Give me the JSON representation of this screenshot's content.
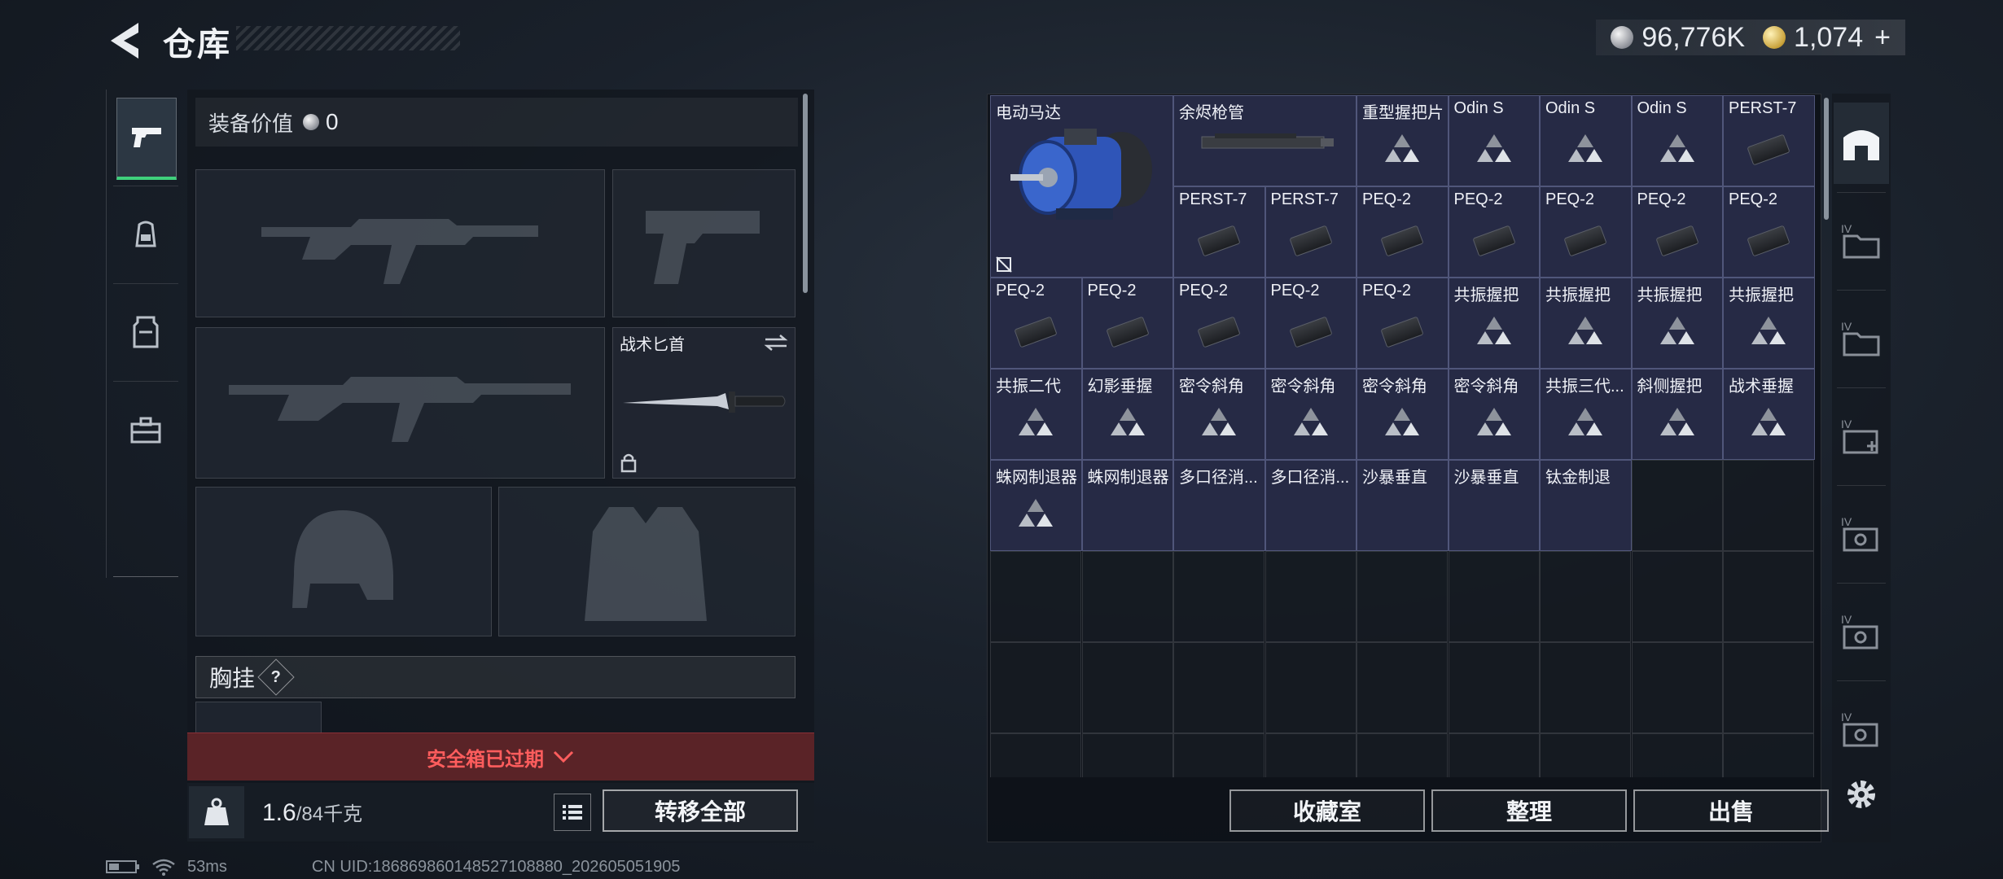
{
  "header": {
    "title": "仓库"
  },
  "currency": [
    {
      "icon": "silver-coin-icon",
      "value": "96,776K"
    },
    {
      "icon": "gold-coin-icon",
      "value": "1,074"
    }
  ],
  "currency_plus": "+",
  "equipment": {
    "value_label": "装备价值",
    "value": "0",
    "knife_label": "战术匕首",
    "chest_rig_label": "胸挂",
    "chest_rig_help": "?",
    "safebox_status": "安全箱已过期",
    "weight_current": "1.6",
    "weight_suffix": "/84千克",
    "transfer_all": "转移全部"
  },
  "stash": {
    "items": [
      {
        "name": "电动马达",
        "icon": "motor"
      },
      {
        "name": "余烬枪管",
        "icon": "barrel"
      },
      {
        "name": "重型握把片",
        "icon": "tri"
      },
      {
        "name": "Odin S",
        "icon": "tri"
      },
      {
        "name": "Odin S",
        "icon": "tri"
      },
      {
        "name": "Odin S",
        "icon": "tri"
      },
      {
        "name": "PERST-7",
        "icon": "attach"
      },
      {
        "name": "PERST-7",
        "icon": "attach"
      },
      {
        "name": "PERST-7",
        "icon": "attach"
      },
      {
        "name": "PEQ-2",
        "icon": "attach"
      },
      {
        "name": "PEQ-2",
        "icon": "attach"
      },
      {
        "name": "PEQ-2",
        "icon": "attach"
      },
      {
        "name": "PEQ-2",
        "icon": "attach"
      },
      {
        "name": "PEQ-2",
        "icon": "attach"
      },
      {
        "name": "PEQ-2",
        "icon": "attach"
      },
      {
        "name": "PEQ-2",
        "icon": "attach"
      },
      {
        "name": "PEQ-2",
        "icon": "attach"
      },
      {
        "name": "PEQ-2",
        "icon": "attach"
      },
      {
        "name": "PEQ-2",
        "icon": "attach"
      },
      {
        "name": "共振握把",
        "icon": "tri"
      },
      {
        "name": "共振握把",
        "icon": "tri"
      },
      {
        "name": "共振握把",
        "icon": "tri"
      },
      {
        "name": "共振握把",
        "icon": "tri"
      },
      {
        "name": "共振二代",
        "icon": "tri"
      },
      {
        "name": "幻影垂握",
        "icon": "tri"
      },
      {
        "name": "密令斜角",
        "icon": "tri"
      },
      {
        "name": "密令斜角",
        "icon": "tri"
      },
      {
        "name": "密令斜角",
        "icon": "tri"
      },
      {
        "name": "密令斜角",
        "icon": "tri"
      },
      {
        "name": "共振三代...",
        "icon": "tri"
      },
      {
        "name": "斜侧握把",
        "icon": "tri"
      },
      {
        "name": "战术垂握",
        "icon": "tri"
      },
      {
        "name": "蛛网制退器",
        "icon": "tri"
      },
      {
        "name": "蛛网制退器",
        "icon": "none"
      },
      {
        "name": "多口径消...",
        "icon": "none"
      },
      {
        "name": "多口径消...",
        "icon": "none"
      },
      {
        "name": "沙暴垂直",
        "icon": "none"
      },
      {
        "name": "沙暴垂直",
        "icon": "none"
      },
      {
        "name": "钛金制退",
        "icon": "none"
      }
    ],
    "actions": {
      "collection": "收藏室",
      "sort": "整理",
      "sell": "出售"
    }
  },
  "status": {
    "ping": "53ms",
    "uid": "CN UID:186869860148527108880_202605051905"
  },
  "colors": {
    "accent_green": "#3fd07c",
    "warning_red": "#ff5d5d",
    "item_bg": "#262a45"
  }
}
